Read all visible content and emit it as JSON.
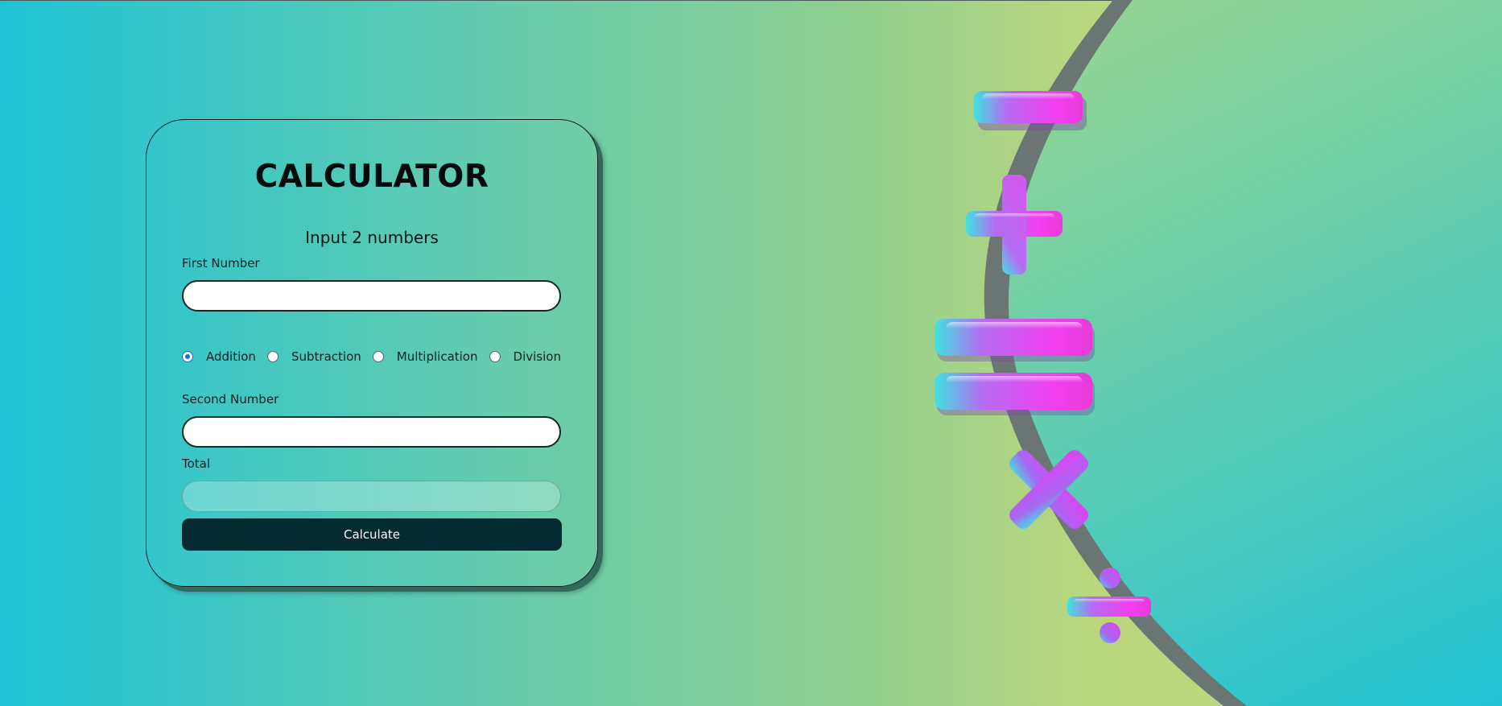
{
  "calculator": {
    "title": "CALCULATOR",
    "subtitle": "Input 2 numbers",
    "first_label": "First Number",
    "first_value": "",
    "second_label": "Second Number",
    "second_value": "",
    "total_label": "Total",
    "total_value": "",
    "operations": [
      {
        "label": "Addition",
        "checked": true
      },
      {
        "label": "Subtraction",
        "checked": false
      },
      {
        "label": "Multiplication",
        "checked": false
      },
      {
        "label": "Division",
        "checked": false
      }
    ],
    "button_label": "Calculate"
  },
  "decoration": {
    "symbols": [
      "minus-symbol",
      "plus-symbol",
      "equals-symbol",
      "multiply-symbol",
      "divide-symbol"
    ],
    "colors": {
      "arc": "#6b7573",
      "symbol_magenta": "#f33ff0",
      "symbol_violet": "#b56cf2",
      "symbol_cyan": "#3fe3e0"
    }
  },
  "colors": {
    "button_bg": "#042a32",
    "card_border": "#0b1e1e",
    "radio_accent": "#1a6fd8"
  }
}
